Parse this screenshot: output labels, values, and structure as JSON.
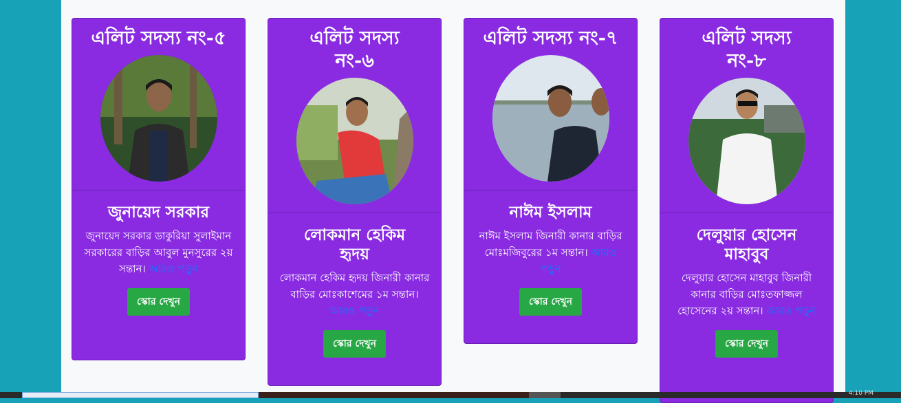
{
  "members": [
    {
      "title": "এলিট সদস্য নং-৫",
      "name": "জুনায়েদ সরকার",
      "description": "জুনায়েদ সরকার ডাকুরিয়া সুলাইমান সরকারের বাড়ির আবুল মুনসুরের ২য় সন্তান।",
      "more_link": "আরও পড়ুন",
      "button": "স্কোর দেখুন"
    },
    {
      "title": "এলিট সদস্য নং-৬",
      "name": "লোকমান হেকিম হৃদয়",
      "description": "লোকমান হেকিম হৃদয় জিনারী কানার বাড়ির মোঃকাশেমের ১ম সন্তান।",
      "more_link": "আরও পড়ুন",
      "button": "স্কোর দেখুন"
    },
    {
      "title": "এলিট সদস্য নং-৭",
      "name": "নাঈম ইসলাম",
      "description": "নাঈম ইসলাম জিনারী কানার বাড়ির মোঃমজিবুরের ১ম সন্তান।",
      "more_link": "আরও পড়ুন",
      "button": "স্কোর দেখুন"
    },
    {
      "title": "এলিট সদস্য নং-৮",
      "name": "দেলুয়ার হোসেন মাহাবুব",
      "description": "দেলুয়ার হোসেন মাহাবুব জিনারী কানার বাড়ির মোঃতফাজ্জল হোসেনের ২য় সন্তান।",
      "more_link": "আরও পড়ুন",
      "button": "স্কোর দেখুন"
    }
  ],
  "colors": {
    "card_bg": "#8a2be2",
    "page_bg": "#17a2b8",
    "button_bg": "#28a745",
    "link": "#1a73ff"
  },
  "taskbar": {
    "clock": "4:10 PM"
  }
}
